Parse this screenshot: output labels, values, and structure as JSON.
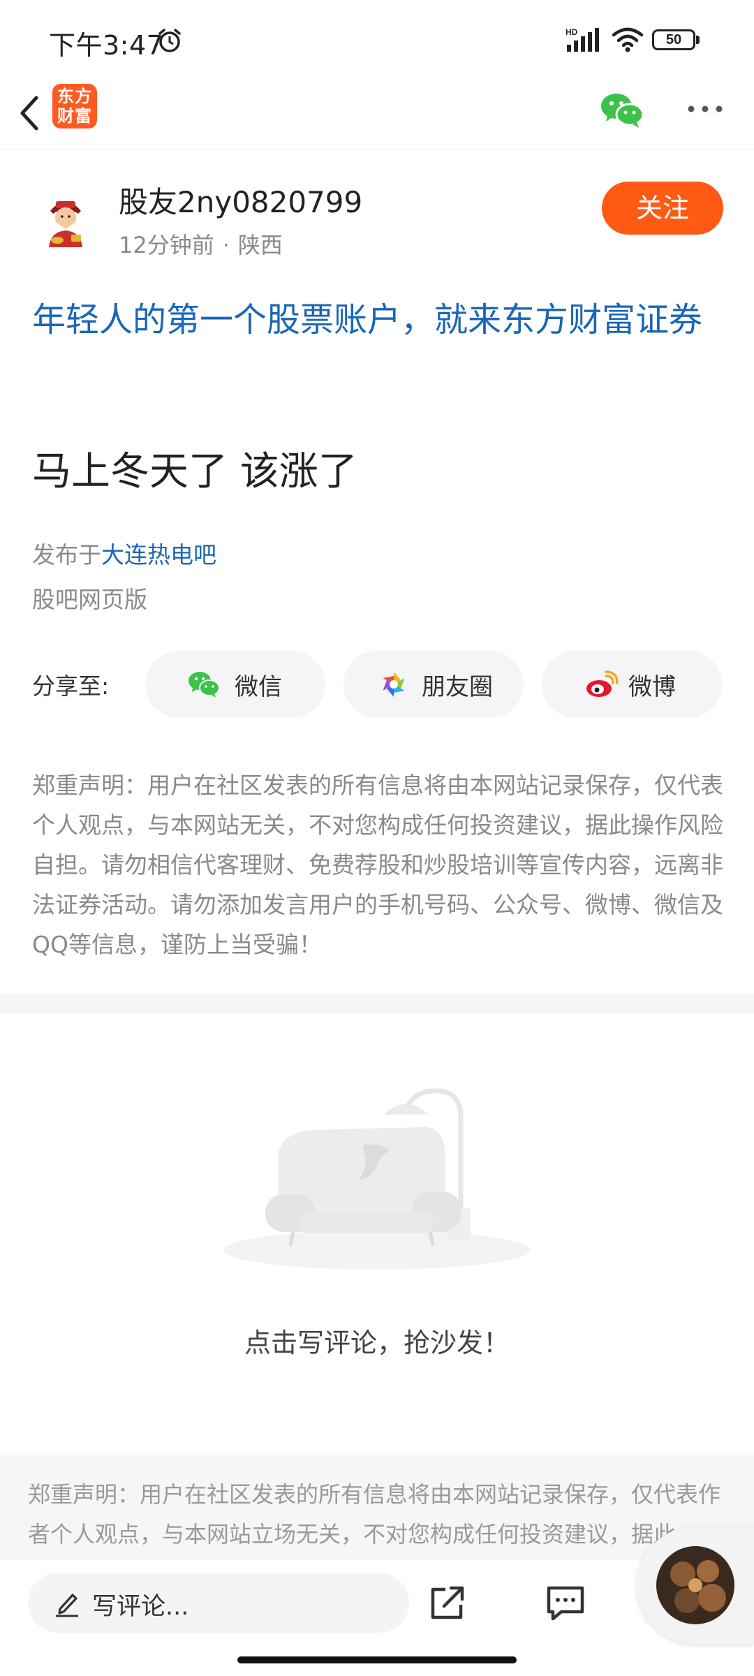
{
  "status_bar": {
    "time": "下午3:47",
    "battery": "50"
  },
  "header": {
    "logo_text_line1": "东方",
    "logo_text_line2": "财富"
  },
  "author": {
    "name": "股友2ny0820799",
    "time_ago": "12分钟前",
    "separator": "·",
    "location": "陕西",
    "follow_label": "关注"
  },
  "post": {
    "promo_link": "年轻人的第一个股票账户，就来东方财富证券",
    "title": "马上冬天了 该涨了",
    "published_prefix": "发布于",
    "bar_name": "大连热电吧",
    "source": "股吧网页版"
  },
  "share": {
    "label": "分享至:",
    "items": [
      {
        "label": "微信",
        "icon": "wechat-icon"
      },
      {
        "label": "朋友圈",
        "icon": "moments-icon"
      },
      {
        "label": "微博",
        "icon": "weibo-icon"
      }
    ]
  },
  "disclaimer": "郑重声明：用户在社区发表的所有信息将由本网站记录保存，仅代表个人观点，与本网站无关，不对您构成任何投资建议，据此操作风险自担。请勿相信代客理财、免费荐股和炒股培训等宣传内容，远离非法证券活动。请勿添加发言用户的手机号码、公众号、微博、微信及QQ等信息，谨防上当受骗！",
  "comments": {
    "empty_text": "点击写评论，抢沙发！"
  },
  "footer_disclaimer": "郑重声明：用户在社区发表的所有信息将由本网站记录保存，仅代表作者个人观点，与本网站立场无关，不对您构成任何投资建议，据此",
  "bottom_bar": {
    "comment_placeholder": "写评论..."
  },
  "colors": {
    "accent": "#ff5a14",
    "link": "#1a66b8",
    "muted": "#8a8a8a"
  }
}
